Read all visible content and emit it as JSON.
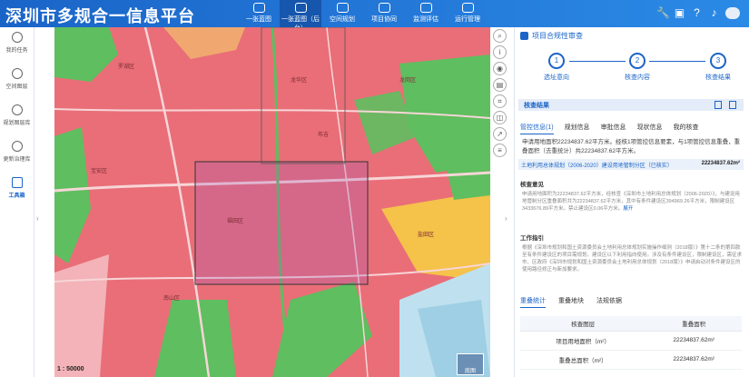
{
  "app": {
    "title": "深圳市多规合一信息平台"
  },
  "nav": [
    {
      "label": "一张蓝图",
      "icon": "map-icon"
    },
    {
      "label": "一张蓝图（后台）",
      "icon": "map-admin-icon"
    },
    {
      "label": "空间规划",
      "icon": "plan-icon"
    },
    {
      "label": "项目协同",
      "icon": "project-icon"
    },
    {
      "label": "监测评估",
      "icon": "monitor-icon"
    },
    {
      "label": "运行管理",
      "icon": "manage-icon"
    }
  ],
  "nav_active_index": 1,
  "sidebar": [
    {
      "label": "我的任务",
      "icon": "clock-icon"
    },
    {
      "label": "空间图层",
      "icon": "layers-icon"
    },
    {
      "label": "规划图层库",
      "icon": "book-icon"
    },
    {
      "label": "更新治理库",
      "icon": "database-icon"
    },
    {
      "label": "工具箱",
      "icon": "hash-icon",
      "active": true
    }
  ],
  "map": {
    "scale": "1 : 50000",
    "thumbnail_label": "底图",
    "labels": [
      "罗湖区",
      "福田区",
      "南山区",
      "宝安区",
      "龙华区",
      "盐田区",
      "龙岗区",
      "布吉"
    ]
  },
  "panel": {
    "title": "项目合规性审查",
    "steps": [
      {
        "num": "1",
        "label": "选址意向"
      },
      {
        "num": "2",
        "label": "核查内容"
      },
      {
        "num": "3",
        "label": "核查结果"
      }
    ],
    "section": "核查结果",
    "tabs": [
      "管控信息(1)",
      "规划信息",
      "审批信息",
      "现状信息",
      "我的核查"
    ],
    "summary": "申请用地面积22234837.62平方米。经核1项管控信息要素，与1项管控信息重叠，重叠面积（去重统计）共22234837.62平方米。",
    "info_row": {
      "label": "土地利用总体规划（2006-2020）建设用地管制分区（已核实）",
      "value": "22234837.62m²"
    },
    "check_title": "核查意见",
    "check_text": "申请用地面积为22234837.62平方米，经核查《深圳市土地利用总体规划（2006-2020）》，与建设用地管制分区重叠面积共为22234837.62平方米，其中有条件建设区394969.26平方米，限制建设区3433676.89平方米。禁止建设区0.06平方米。",
    "check_link": "展开",
    "tip_title": "工作指引",
    "tip_text": "根据《深圳市规划和国土资源委员会土地利用总体规划实施操作细则（2018版）》第十二条的第四款至有条件建设区的项目需规划。建设区以下利用指向使用。涉及有条件建设区，限制建设区，需征求市、区政府《深圳市规划和国土资源委员会土地利用总体规划（2018版）》申请启动对条件建设区的使用路径修正与新加要求。",
    "bottom_tabs": [
      "重叠统计",
      "重叠地块",
      "法规依据"
    ],
    "table": {
      "headers": [
        "核查图层",
        "重叠面积"
      ],
      "rows": [
        [
          "项目用地面积（m²）",
          "22234837.62m²"
        ],
        [
          "重叠总面积（m²）",
          "22234837.62m²"
        ]
      ]
    }
  },
  "map_tools": [
    "search-icon",
    "info-icon",
    "location-icon",
    "ruler-icon",
    "crop-icon",
    "overlay-icon",
    "share-icon",
    "layers-icon"
  ],
  "colors": {
    "brand": "#1a64c8",
    "map_pink": "#e96e78",
    "map_green": "#5fbe5f",
    "map_yellow": "#f5c24a",
    "map_water": "#bfe0ee"
  }
}
